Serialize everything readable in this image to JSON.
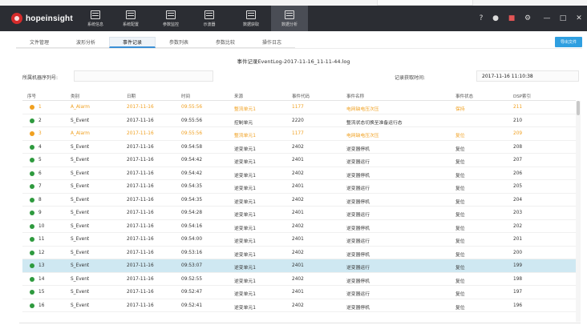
{
  "app": {
    "logo_text": "hopeinsight"
  },
  "nav": [
    {
      "label": "系统信息",
      "icon": "system-info-icon"
    },
    {
      "label": "系统配置",
      "icon": "system-config-icon"
    },
    {
      "label": "参数监控",
      "icon": "param-monitor-icon"
    },
    {
      "label": "示波器",
      "icon": "oscilloscope-icon"
    },
    {
      "label": "数据获取",
      "icon": "data-acquire-icon"
    },
    {
      "label": "数据分析",
      "icon": "data-analysis-icon"
    }
  ],
  "active_nav": 5,
  "window_controls": [
    "?",
    "●",
    "■",
    "⚙",
    "—",
    "□",
    "✕"
  ],
  "tabs": [
    "文件管理",
    "波形分析",
    "事件记录",
    "参数列表",
    "参数比较",
    "操作日志"
  ],
  "active_tab": 2,
  "export_label": "导出文件",
  "file_title": "事件记录EventLog-2017-11-16_11-11-44.log",
  "device_serial_label": "所属机器序列号:",
  "device_serial_value": "",
  "record_time_label": "记录获取时间:",
  "record_time_value": "2017-11-16 11:10:38",
  "table": {
    "columns": [
      "序号",
      "类别",
      "日期",
      "时间",
      "来源",
      "事件代码",
      "事件名称",
      "事件状态",
      "DSP索引"
    ],
    "rows": [
      {
        "no": "1",
        "type": "A_Alarm",
        "date": "2017-11-16",
        "time": "09:55:56",
        "source": "整流单元1",
        "code": "1177",
        "name": "电网缺电压次压",
        "state": "保持",
        "dsp": "211",
        "warn": true
      },
      {
        "no": "2",
        "type": "S_Event",
        "date": "2017-11-16",
        "time": "09:55:56",
        "source": "控制单元",
        "code": "2220",
        "name": "整流状态切换至准备运行态",
        "state": "",
        "dsp": "210",
        "warn": false
      },
      {
        "no": "3",
        "type": "A_Alarm",
        "date": "2017-11-16",
        "time": "09:55:56",
        "source": "整流单元1",
        "code": "1177",
        "name": "电网缺电压次压",
        "state": "复位",
        "dsp": "209",
        "warn": true
      },
      {
        "no": "4",
        "type": "S_Event",
        "date": "2017-11-16",
        "time": "09:54:58",
        "source": "逆变单元1",
        "code": "2402",
        "name": "逆变器停机",
        "state": "复位",
        "dsp": "208",
        "warn": false
      },
      {
        "no": "5",
        "type": "S_Event",
        "date": "2017-11-16",
        "time": "09:54:42",
        "source": "逆变单元1",
        "code": "2401",
        "name": "逆变器运行",
        "state": "复位",
        "dsp": "207",
        "warn": false
      },
      {
        "no": "6",
        "type": "S_Event",
        "date": "2017-11-16",
        "time": "09:54:42",
        "source": "逆变单元1",
        "code": "2402",
        "name": "逆变器停机",
        "state": "复位",
        "dsp": "206",
        "warn": false
      },
      {
        "no": "7",
        "type": "S_Event",
        "date": "2017-11-16",
        "time": "09:54:35",
        "source": "逆变单元1",
        "code": "2401",
        "name": "逆变器运行",
        "state": "复位",
        "dsp": "205",
        "warn": false
      },
      {
        "no": "8",
        "type": "S_Event",
        "date": "2017-11-16",
        "time": "09:54:35",
        "source": "逆变单元1",
        "code": "2402",
        "name": "逆变器停机",
        "state": "复位",
        "dsp": "204",
        "warn": false
      },
      {
        "no": "9",
        "type": "S_Event",
        "date": "2017-11-16",
        "time": "09:54:28",
        "source": "逆变单元1",
        "code": "2401",
        "name": "逆变器运行",
        "state": "复位",
        "dsp": "203",
        "warn": false
      },
      {
        "no": "10",
        "type": "S_Event",
        "date": "2017-11-16",
        "time": "09:54:16",
        "source": "逆变单元1",
        "code": "2402",
        "name": "逆变器停机",
        "state": "复位",
        "dsp": "202",
        "warn": false
      },
      {
        "no": "11",
        "type": "S_Event",
        "date": "2017-11-16",
        "time": "09:54:00",
        "source": "逆变单元1",
        "code": "2401",
        "name": "逆变器运行",
        "state": "复位",
        "dsp": "201",
        "warn": false
      },
      {
        "no": "12",
        "type": "S_Event",
        "date": "2017-11-16",
        "time": "09:53:16",
        "source": "逆变单元1",
        "code": "2402",
        "name": "逆变器停机",
        "state": "复位",
        "dsp": "200",
        "warn": false
      },
      {
        "no": "13",
        "type": "S_Event",
        "date": "2017-11-16",
        "time": "09:53:07",
        "source": "逆变单元1",
        "code": "2401",
        "name": "逆变器运行",
        "state": "复位",
        "dsp": "199",
        "warn": false
      },
      {
        "no": "14",
        "type": "S_Event",
        "date": "2017-11-16",
        "time": "09:52:55",
        "source": "逆变单元1",
        "code": "2402",
        "name": "逆变器停机",
        "state": "复位",
        "dsp": "198",
        "warn": false
      },
      {
        "no": "15",
        "type": "S_Event",
        "date": "2017-11-16",
        "time": "09:52:47",
        "source": "逆变单元1",
        "code": "2401",
        "name": "逆变器运行",
        "state": "复位",
        "dsp": "197",
        "warn": false
      },
      {
        "no": "16",
        "type": "S_Event",
        "date": "2017-11-16",
        "time": "09:52:41",
        "source": "逆变单元1",
        "code": "2402",
        "name": "逆变器停机",
        "state": "复位",
        "dsp": "196",
        "warn": false
      }
    ],
    "selected_row": 12
  },
  "colors": {
    "topbar": "#2b2d33",
    "accent": "#2f9fe0",
    "warn": "#f0a020",
    "ok": "#2e9a3e",
    "selected_row": "#cfe8f2"
  }
}
